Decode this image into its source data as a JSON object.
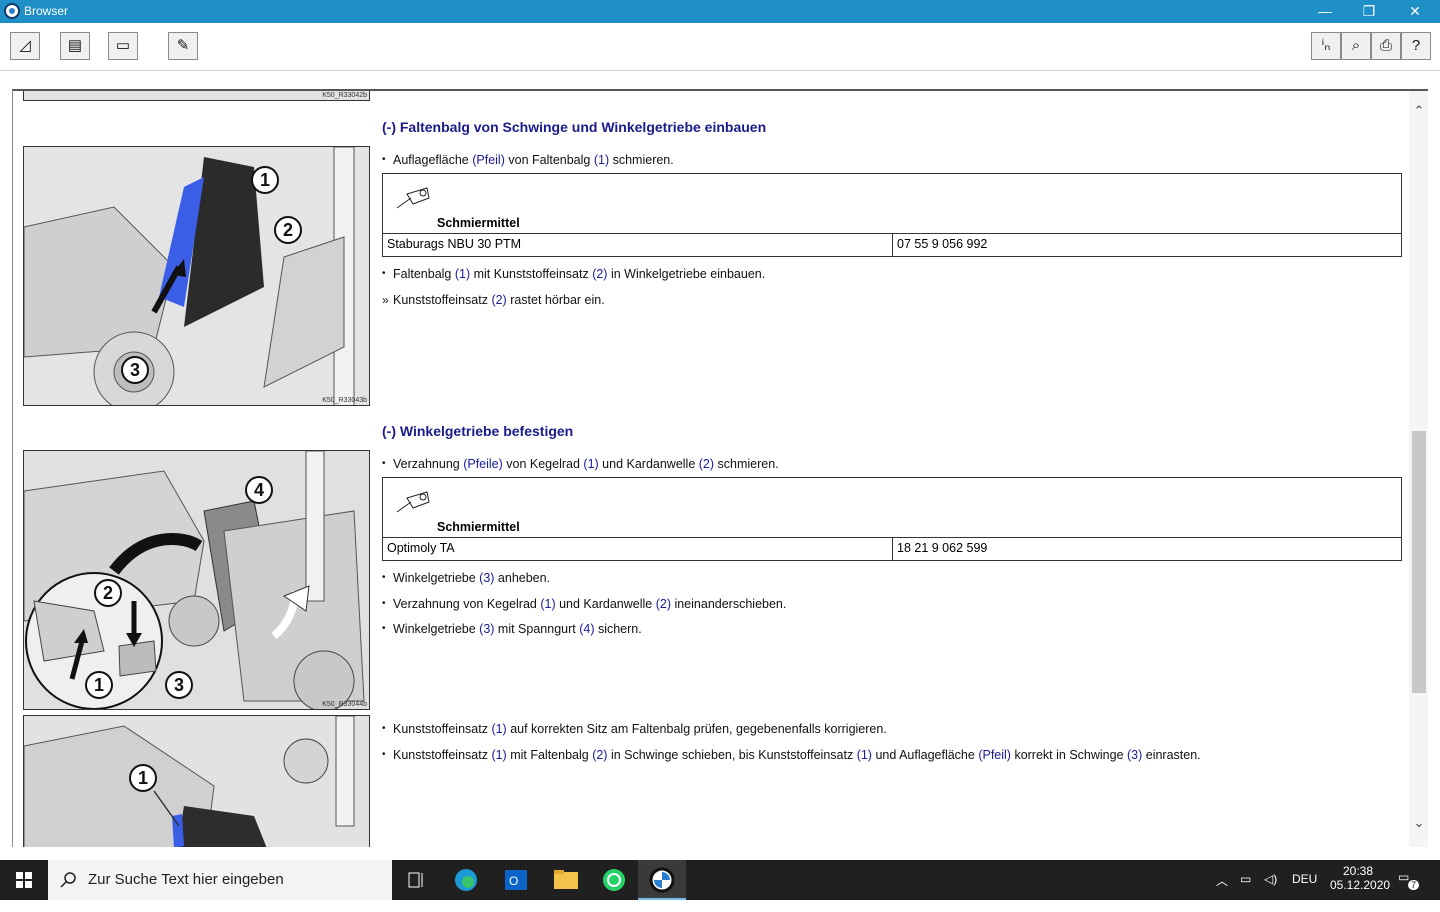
{
  "window": {
    "title": "Browser",
    "minimize": "—",
    "restore": "❐",
    "close": "✕"
  },
  "toolbar": {
    "left": [
      {
        "name": "nav-icon",
        "glyph": "◿"
      },
      {
        "name": "document-icon",
        "glyph": "▤"
      },
      {
        "name": "photo-icon",
        "glyph": "▭"
      },
      {
        "name": "pen-icon",
        "glyph": "✎"
      }
    ],
    "right": [
      {
        "name": "info-icon",
        "glyph": "ⁱₙ"
      },
      {
        "name": "binoculars-icon",
        "glyph": "⌕"
      },
      {
        "name": "print-icon",
        "glyph": "⎙"
      },
      {
        "name": "help-icon",
        "glyph": "?"
      }
    ]
  },
  "figures": {
    "top_code": "K50_R33042b",
    "fig1": {
      "code": "K50_R33043b",
      "marks": [
        "1",
        "2",
        "3"
      ]
    },
    "fig2": {
      "code": "K50_R33044b",
      "marks": [
        "4",
        "2",
        "1",
        "3"
      ]
    },
    "fig3": {
      "marks": [
        "1"
      ]
    }
  },
  "sections": {
    "s1": {
      "heading": "(-) Faltenbalg von Schwinge und Winkelgetriebe einbauen",
      "step1": [
        "Auflagefläche ",
        "(Pfeil)",
        " von Faltenbalg ",
        "(1)",
        " schmieren."
      ],
      "lube_label": "Schmiermittel",
      "lube_name": "Staburags NBU 30 PTM",
      "lube_number": "07 55 9 056 992",
      "step2": [
        "Faltenbalg ",
        "(1)",
        " mit Kunststoffeinsatz ",
        "(2)",
        " in Winkelgetriebe einbauen."
      ],
      "step3": [
        "Kunststoffeinsatz ",
        "(2)",
        " rastet hörbar ein."
      ]
    },
    "s2": {
      "heading": "(-) Winkelgetriebe befestigen",
      "step1": [
        "Verzahnung ",
        "(Pfeile)",
        " von Kegelrad ",
        "(1)",
        " und Kardanwelle ",
        "(2)",
        " schmieren."
      ],
      "lube_label": "Schmiermittel",
      "lube_name": "Optimoly TA",
      "lube_number": "18 21 9 062 599",
      "step2": [
        "Winkelgetriebe ",
        "(3)",
        " anheben."
      ],
      "step3": [
        "Verzahnung von Kegelrad ",
        "(1)",
        " und Kardanwelle ",
        "(2)",
        " ineinanderschieben."
      ],
      "step4": [
        "Winkelgetriebe ",
        "(3)",
        " mit Spanngurt ",
        "(4)",
        " sichern."
      ]
    },
    "s3": {
      "step1": [
        "Kunststoffeinsatz ",
        "(1)",
        " auf korrekten Sitz am Faltenbalg prüfen, gegebenenfalls korrigieren."
      ],
      "step2": [
        "Kunststoffeinsatz ",
        "(1)",
        " mit Faltenbalg ",
        "(2)",
        " in Schwinge schieben, bis Kunststoffeinsatz ",
        "(1)",
        " und Auflagefläche ",
        "(Pfeil)",
        " korrekt in Schwinge ",
        "(3)",
        " einrasten."
      ]
    }
  },
  "taskbar": {
    "search_placeholder": "Zur Suche Text hier eingeben",
    "lang": "DEU",
    "time": "20:38",
    "date": "05.12.2020",
    "notifications": "7"
  }
}
